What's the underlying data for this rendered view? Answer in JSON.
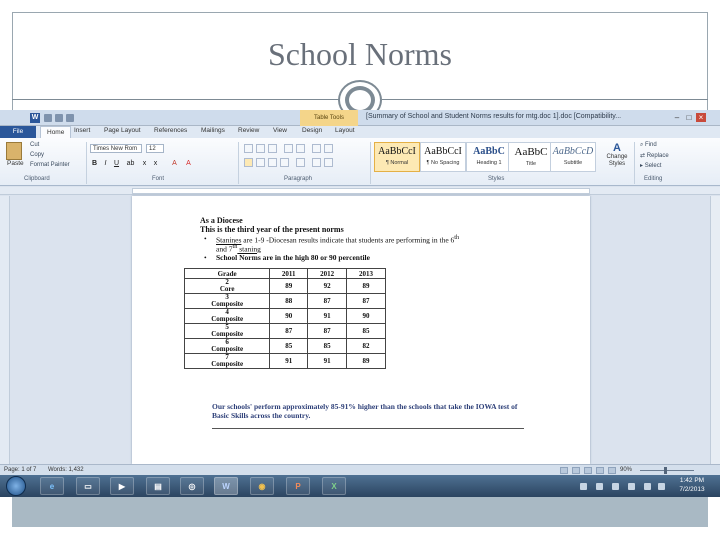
{
  "slide": {
    "title": "School Norms"
  },
  "window": {
    "context_tab": "Table Tools",
    "doc_title": "[Summary of School and Student Norms results for mtg.doc 1].doc [Compatibility..."
  },
  "ribbon": {
    "tabs": [
      "File",
      "Home",
      "Insert",
      "Page Layout",
      "References",
      "Mailings",
      "Review",
      "View",
      "Design",
      "Layout"
    ],
    "clipboard": {
      "paste": "Paste",
      "cut": "Cut",
      "copy": "Copy",
      "format_painter": "Format Painter",
      "group": "Clipboard"
    },
    "font": {
      "name": "Times New Rom",
      "size": "12",
      "group": "Font"
    },
    "paragraph": {
      "group": "Paragraph"
    },
    "styles": {
      "group": "Styles",
      "items": [
        {
          "sample": "AaBbCcI",
          "name": "¶ Normal"
        },
        {
          "sample": "AaBbCcI",
          "name": "¶ No Spacing"
        },
        {
          "sample": "AaBbC",
          "name": "Heading 1"
        },
        {
          "sample": "AaBbC",
          "name": "Title"
        },
        {
          "sample": "AaBbCcD",
          "name": "Subtitle"
        }
      ],
      "change_styles": "Change Styles"
    },
    "editing": {
      "find": "Find",
      "replace": "Replace",
      "select": "Select",
      "group": "Editing"
    }
  },
  "document": {
    "heading1": "As a Diocese",
    "heading2": "This is the third year of the present norms",
    "bullet1_a": "Stanines",
    "bullet1_b": " are 1-9  -Diocesan results indicate that students are performing in the 6",
    "bullet1_sup": "th",
    "bullet1_line2": "and 7",
    "bullet1_line2_sup": "th",
    "bullet1_line2_end": " staning",
    "bullet2": "School Norms are in the high 80 or 90 percentile",
    "table": {
      "headers": [
        "Grade",
        "2011",
        "2012",
        "2013"
      ],
      "rows": [
        {
          "grade_num": "2",
          "grade_label": "Core",
          "v2011": "89",
          "v2012": "92",
          "v2013": "89"
        },
        {
          "grade_num": "3",
          "grade_label": "Composite",
          "v2011": "88",
          "v2012": "87",
          "v2013": "87"
        },
        {
          "grade_num": "4",
          "grade_label": "Composite",
          "v2011": "90",
          "v2012": "91",
          "v2013": "90"
        },
        {
          "grade_num": "5",
          "grade_label": "Composite",
          "v2011": "87",
          "v2012": "87",
          "v2013": "85"
        },
        {
          "grade_num": "6",
          "grade_label": "Composite",
          "v2011": "85",
          "v2012": "85",
          "v2013": "82"
        },
        {
          "grade_num": "7",
          "grade_label": "Composite",
          "v2011": "91",
          "v2012": "91",
          "v2013": "89"
        }
      ]
    },
    "summary": "Our schools' perform  approximately 85-91% higher than the schools that take the IOWA test of Basic Skills across the country."
  },
  "statusbar": {
    "page": "Page: 1 of 7",
    "words": "Words: 1,432",
    "zoom": "90%"
  },
  "taskbar": {
    "time": "1:42 PM",
    "date": "7/2/2013"
  }
}
